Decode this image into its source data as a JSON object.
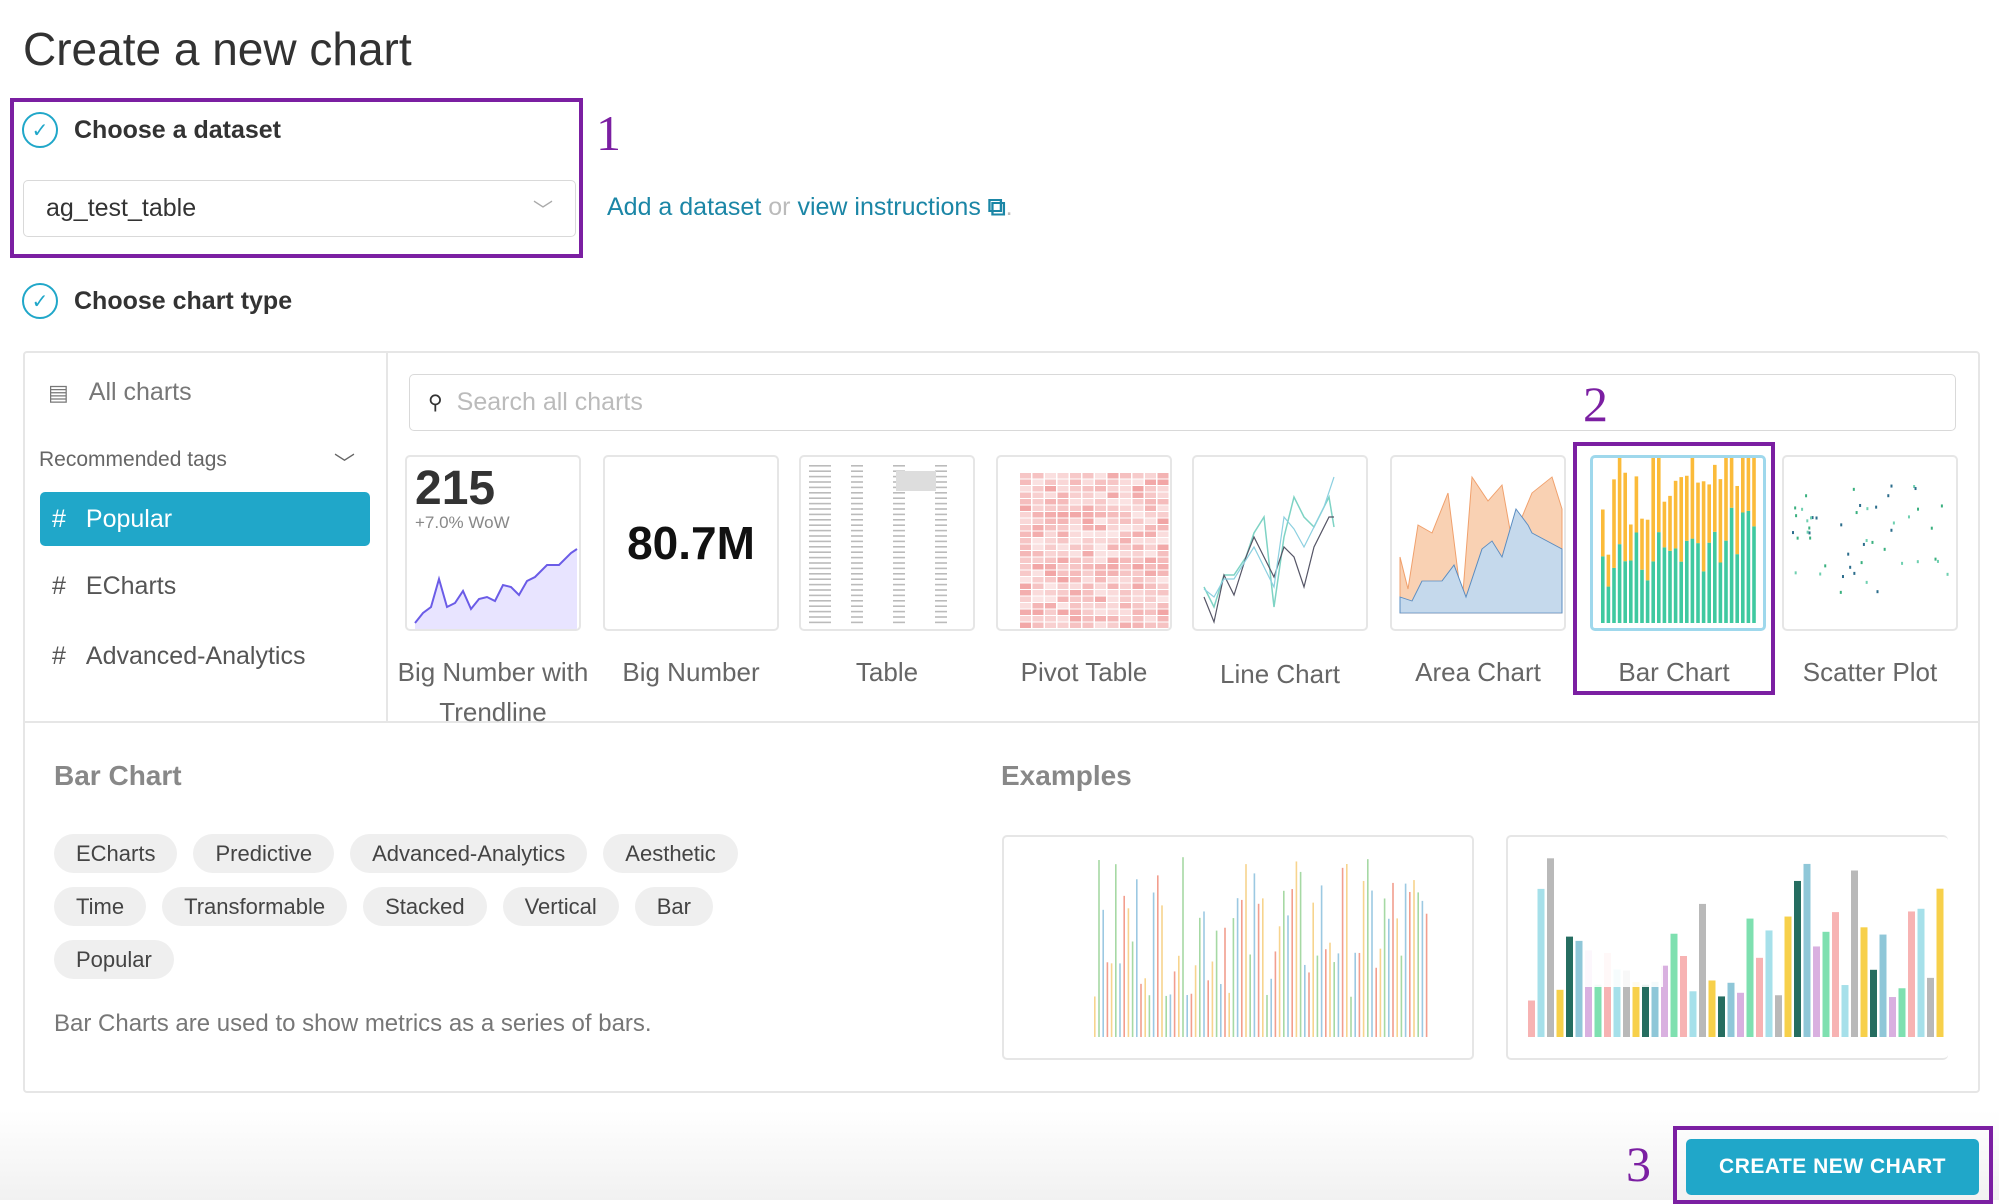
{
  "title": "Create a new chart",
  "dataset_step": {
    "label": "Choose a dataset",
    "selected": "ag_test_table",
    "add_link": "Add a dataset",
    "or": "or",
    "instructions_link": "view instructions",
    "period": "."
  },
  "chart_type_step": {
    "label": "Choose chart type"
  },
  "sidebar": {
    "all_charts": "All charts",
    "recommended_tags": "Recommended tags",
    "tags": [
      {
        "label": "Popular",
        "selected": true
      },
      {
        "label": "ECharts"
      },
      {
        "label": "Advanced-Analytics"
      }
    ]
  },
  "search": {
    "placeholder": "Search all charts"
  },
  "charts": [
    {
      "label": "Big Number with Trendline",
      "value": "215",
      "sub": "+7.0% WoW"
    },
    {
      "label": "Big Number",
      "value": "80.7M"
    },
    {
      "label": "Table"
    },
    {
      "label": "Pivot Table"
    },
    {
      "label": "Line Chart"
    },
    {
      "label": "Area Chart"
    },
    {
      "label": "Bar Chart",
      "selected": true
    },
    {
      "label": "Scatter Plot"
    }
  ],
  "details": {
    "title": "Bar Chart",
    "examples_title": "Examples",
    "tags": [
      "ECharts",
      "Predictive",
      "Advanced-Analytics",
      "Aesthetic",
      "Time",
      "Transformable",
      "Stacked",
      "Vertical",
      "Bar",
      "Popular"
    ],
    "description": "Bar Charts are used to show metrics as a series of bars."
  },
  "create_button": "CREATE NEW CHART",
  "annotations": [
    "1",
    "2",
    "3"
  ],
  "colors": {
    "accent": "#20a7c9",
    "annotation": "#7b1fa2",
    "link": "#1b86a6"
  }
}
